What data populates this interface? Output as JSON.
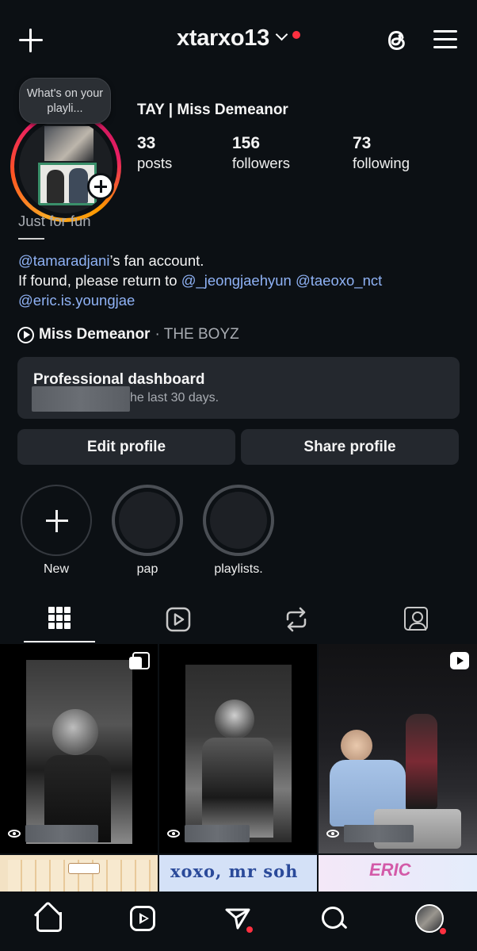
{
  "header": {
    "username": "xtarxo13",
    "icons": {
      "create": "plus-icon",
      "threads": "threads-icon",
      "menu": "hamburger-menu-icon",
      "switch": "chevron-down-icon"
    }
  },
  "profile": {
    "note": "What's on your playli...",
    "display_name": "TAY | Miss Demeanor",
    "stats": [
      {
        "value": "33",
        "label": "posts"
      },
      {
        "value": "156",
        "label": "followers"
      },
      {
        "value": "73",
        "label": "following"
      }
    ],
    "category": "Just for fun",
    "bio_line1_mention": "@tamaradjani",
    "bio_line1_rest": "’s fan account.",
    "bio_line2_prefix": "If found, please return to ",
    "bio_mention2": "@_jeongjaehyun",
    "bio_mention3": "@taeoxo_nct",
    "bio_mention4": "@eric.is.youngjae",
    "music": {
      "song": "Miss Demeanor",
      "separator": " · ",
      "artist": "THE BOYZ"
    }
  },
  "dashboard": {
    "title": "Professional dashboard",
    "subtitle_visible": "he last 30 days."
  },
  "buttons": {
    "edit": "Edit profile",
    "share": "Share profile"
  },
  "highlights": [
    {
      "label": "New"
    },
    {
      "label": "pap"
    },
    {
      "label": "playlists."
    }
  ],
  "tabs": [
    "grid-icon",
    "reels-icon",
    "reposts-icon",
    "tagged-icon"
  ],
  "bottom_nav": [
    "home-icon",
    "reels-icon",
    "send-icon",
    "search-icon",
    "profile-avatar"
  ],
  "row2_text": {
    "middle": "xoxo, mr soh",
    "right": "ERIC"
  },
  "colors": {
    "background": "#0c1014",
    "card": "#24282e",
    "link": "#8fb2f5",
    "notification": "#ff3040"
  }
}
